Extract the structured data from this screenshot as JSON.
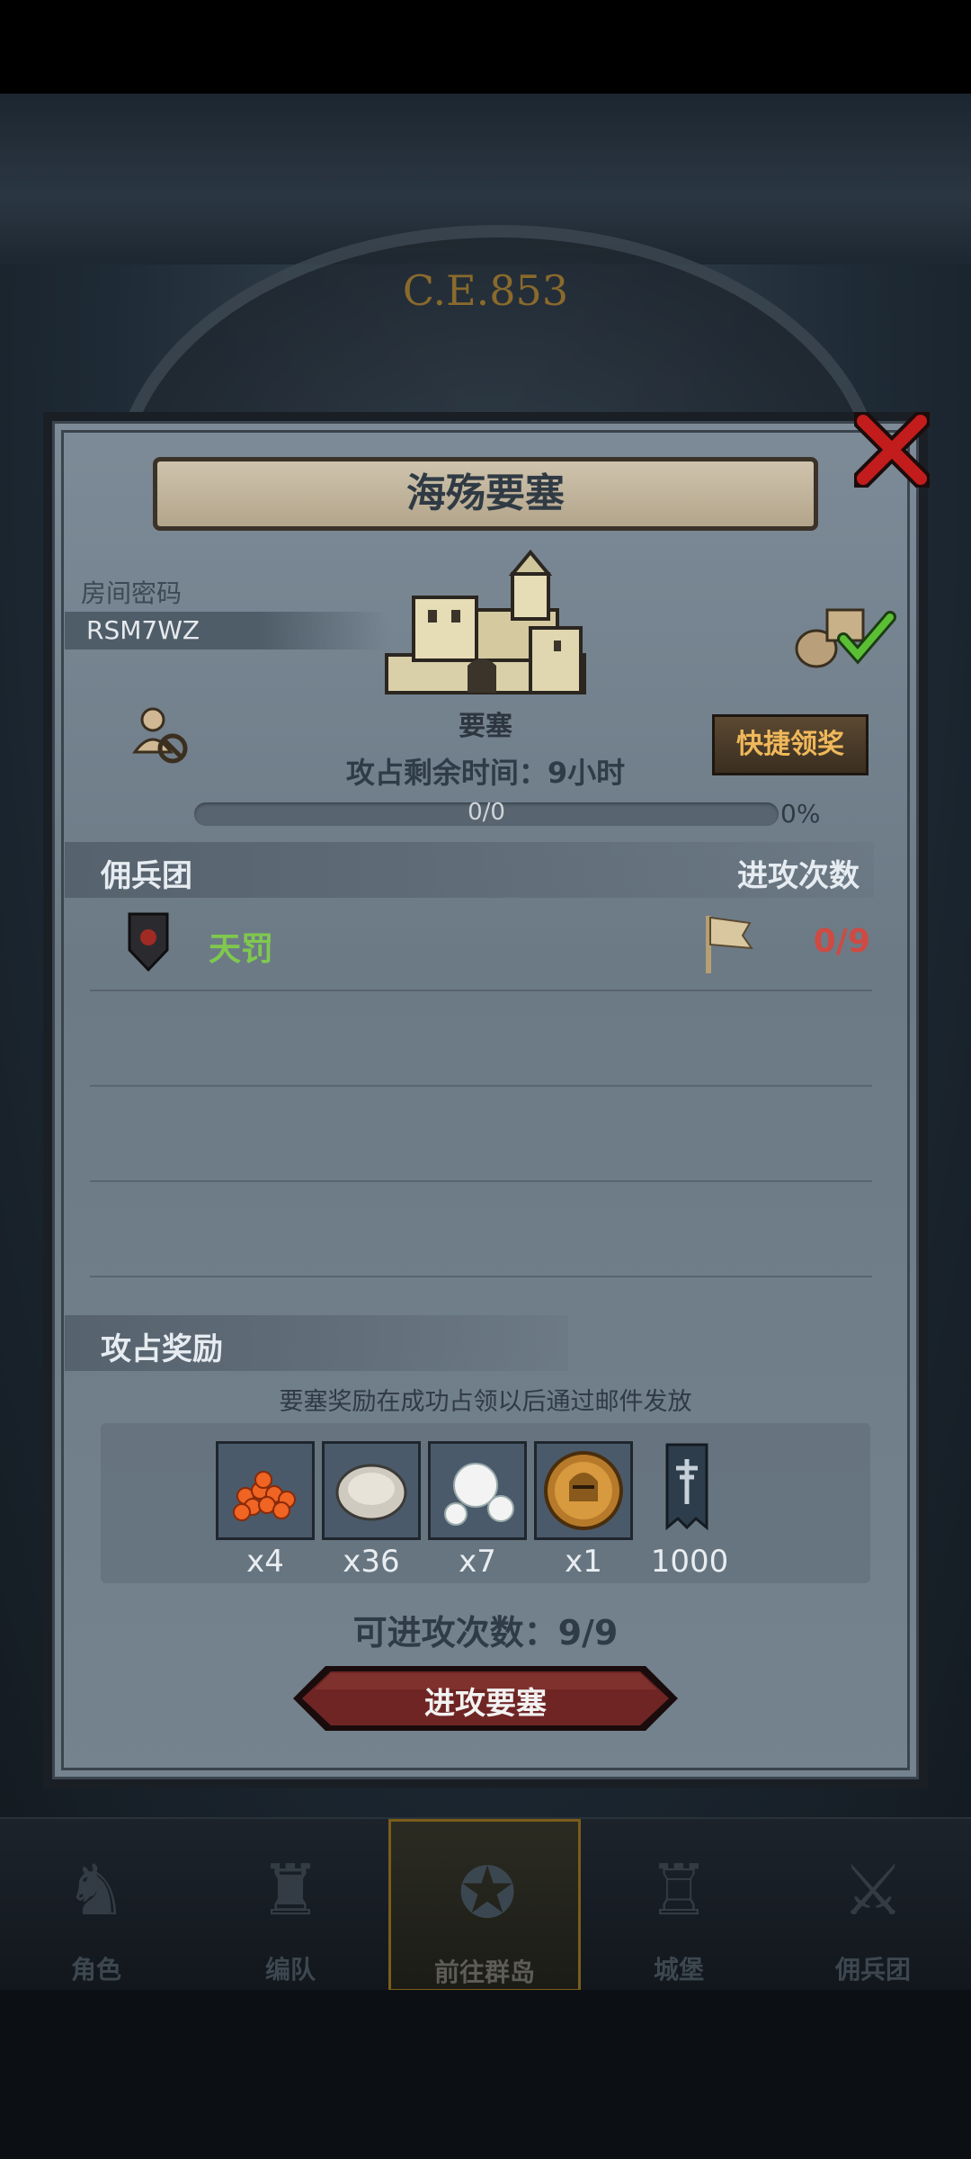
{
  "background": {
    "era_label": "C.E.853"
  },
  "bottom_nav": [
    {
      "label": "角色",
      "icon": "knight-helmet-icon"
    },
    {
      "label": "编队",
      "icon": "formation-icon"
    },
    {
      "label": "前往群岛",
      "icon": "islands-compass-icon",
      "active": true
    },
    {
      "label": "城堡",
      "icon": "castle-icon"
    },
    {
      "label": "佣兵团",
      "icon": "mercenary-icon"
    }
  ],
  "dialog": {
    "title": "海殇要塞",
    "room_code_label": "房间密码",
    "room_code": "RSM7WZ",
    "fortress_name": "要塞",
    "quick_claim_label": "快捷领奖",
    "occupy_time": "攻占剩余时间：9小时",
    "progress_text": "0/0",
    "progress_percent": "0%",
    "progress_value": 0,
    "mercenary_header": "佣兵团",
    "attack_count_header": "进攻次数",
    "mercenary_rows": [
      {
        "name": "天罚",
        "attacks": "0/9",
        "name_color": "#7fc94e",
        "count_color": "#cf4a42"
      }
    ],
    "rewards_header": "攻占奖励",
    "rewards_note": "要塞奖励在成功占领以后通过邮件发放",
    "rewards": [
      {
        "icon": "salmon-roe-icon",
        "qty": "x4"
      },
      {
        "icon": "oyster-icon",
        "qty": "x36"
      },
      {
        "icon": "pearl-icon",
        "qty": "x7"
      },
      {
        "icon": "knight-coin-icon",
        "qty": "x1"
      },
      {
        "icon": "banner-icon",
        "qty": "1000"
      }
    ],
    "available_attacks": "可进攻次数：9/9",
    "attack_button_label": "进攻要塞"
  },
  "colors": {
    "close_red": "#c21c1c",
    "quick_text": "#f0b85a",
    "attack_btn": "#6e2524"
  }
}
